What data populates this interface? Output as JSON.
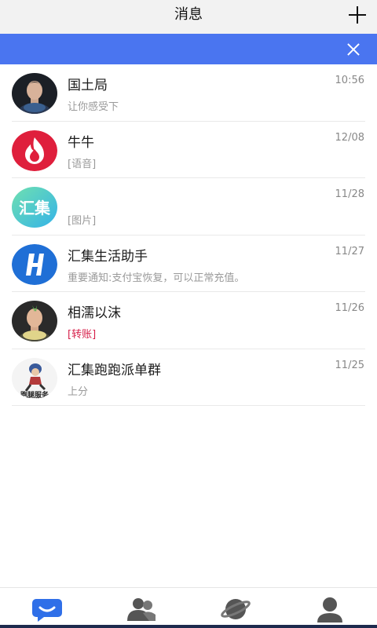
{
  "header": {
    "title": "消息",
    "add_icon": "plus-icon"
  },
  "banner": {
    "close_icon": "close-icon",
    "color": "#4a75f0"
  },
  "conversations": [
    {
      "name": "国土局",
      "time": "10:56",
      "preview": "让你感受下",
      "avatar": "man-avatar",
      "preview_color": "#9a9a9a"
    },
    {
      "name": "牛牛",
      "time": "12/08",
      "preview": "[语音]",
      "avatar": "flame-avatar",
      "preview_color": "#9a9a9a"
    },
    {
      "name": "",
      "time": "11/28",
      "preview": "[图片]",
      "avatar": "huiji-logo-avatar",
      "avatar_text": "汇集",
      "preview_color": "#9a9a9a"
    },
    {
      "name": "汇集生活助手",
      "time": "11/27",
      "preview": "重要通知:支付宝恢复，可以正常充值。",
      "avatar": "h-logo-avatar",
      "preview_color": "#9a9a9a"
    },
    {
      "name": "相濡以沫",
      "time": "11/26",
      "preview": "[转账]",
      "avatar": "punk-avatar",
      "preview_color": "#d61f4a"
    },
    {
      "name": "汇集跑跑派单群",
      "time": "11/25",
      "preview": "上分",
      "avatar": "runner-avatar",
      "avatar_text": "跑腿服务",
      "preview_color": "#9a9a9a"
    }
  ],
  "tabs": [
    {
      "icon": "chat-bubble-icon",
      "active": true,
      "color": "#2f6fe8"
    },
    {
      "icon": "contacts-icon",
      "active": false,
      "color": "#555555"
    },
    {
      "icon": "planet-icon",
      "active": false,
      "color": "#555555"
    },
    {
      "icon": "profile-icon",
      "active": false,
      "color": "#555555"
    }
  ]
}
